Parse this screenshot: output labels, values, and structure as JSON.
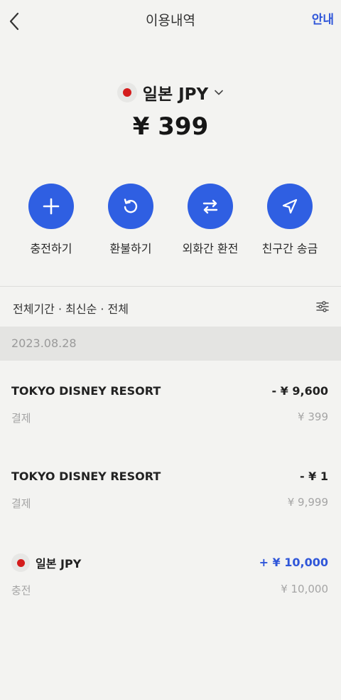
{
  "header": {
    "title": "이용내역",
    "guide_label": "안내"
  },
  "wallet": {
    "currency_name": "일본 JPY",
    "balance": "¥ 399",
    "flag_color": "#d41c1c"
  },
  "actions": [
    {
      "label": "충전하기",
      "icon": "plus-icon"
    },
    {
      "label": "환불하기",
      "icon": "refund-icon"
    },
    {
      "label": "외화간 환전",
      "icon": "exchange-icon"
    },
    {
      "label": "친구간 송금",
      "icon": "send-icon"
    }
  ],
  "filter": {
    "text": "전체기간 · 최신순 · 전체",
    "icon": "filter-settings-icon"
  },
  "date_group": "2023.08.28",
  "transactions": [
    {
      "merchant": "TOKYO DISNEY RESORT",
      "amount": "- ¥ 9,600",
      "type": "결제",
      "balance": "¥ 399"
    },
    {
      "merchant": "TOKYO DISNEY RESORT",
      "amount": "- ¥ 1",
      "type": "결제",
      "balance": "¥ 9,999"
    },
    {
      "merchant": "일본 JPY",
      "amount": "+ ¥ 10,000",
      "type": "충전",
      "balance": "¥ 10,000"
    }
  ],
  "colors": {
    "accent": "#2f5fe2",
    "link": "#2f56d9",
    "background": "#f3f3f1"
  }
}
